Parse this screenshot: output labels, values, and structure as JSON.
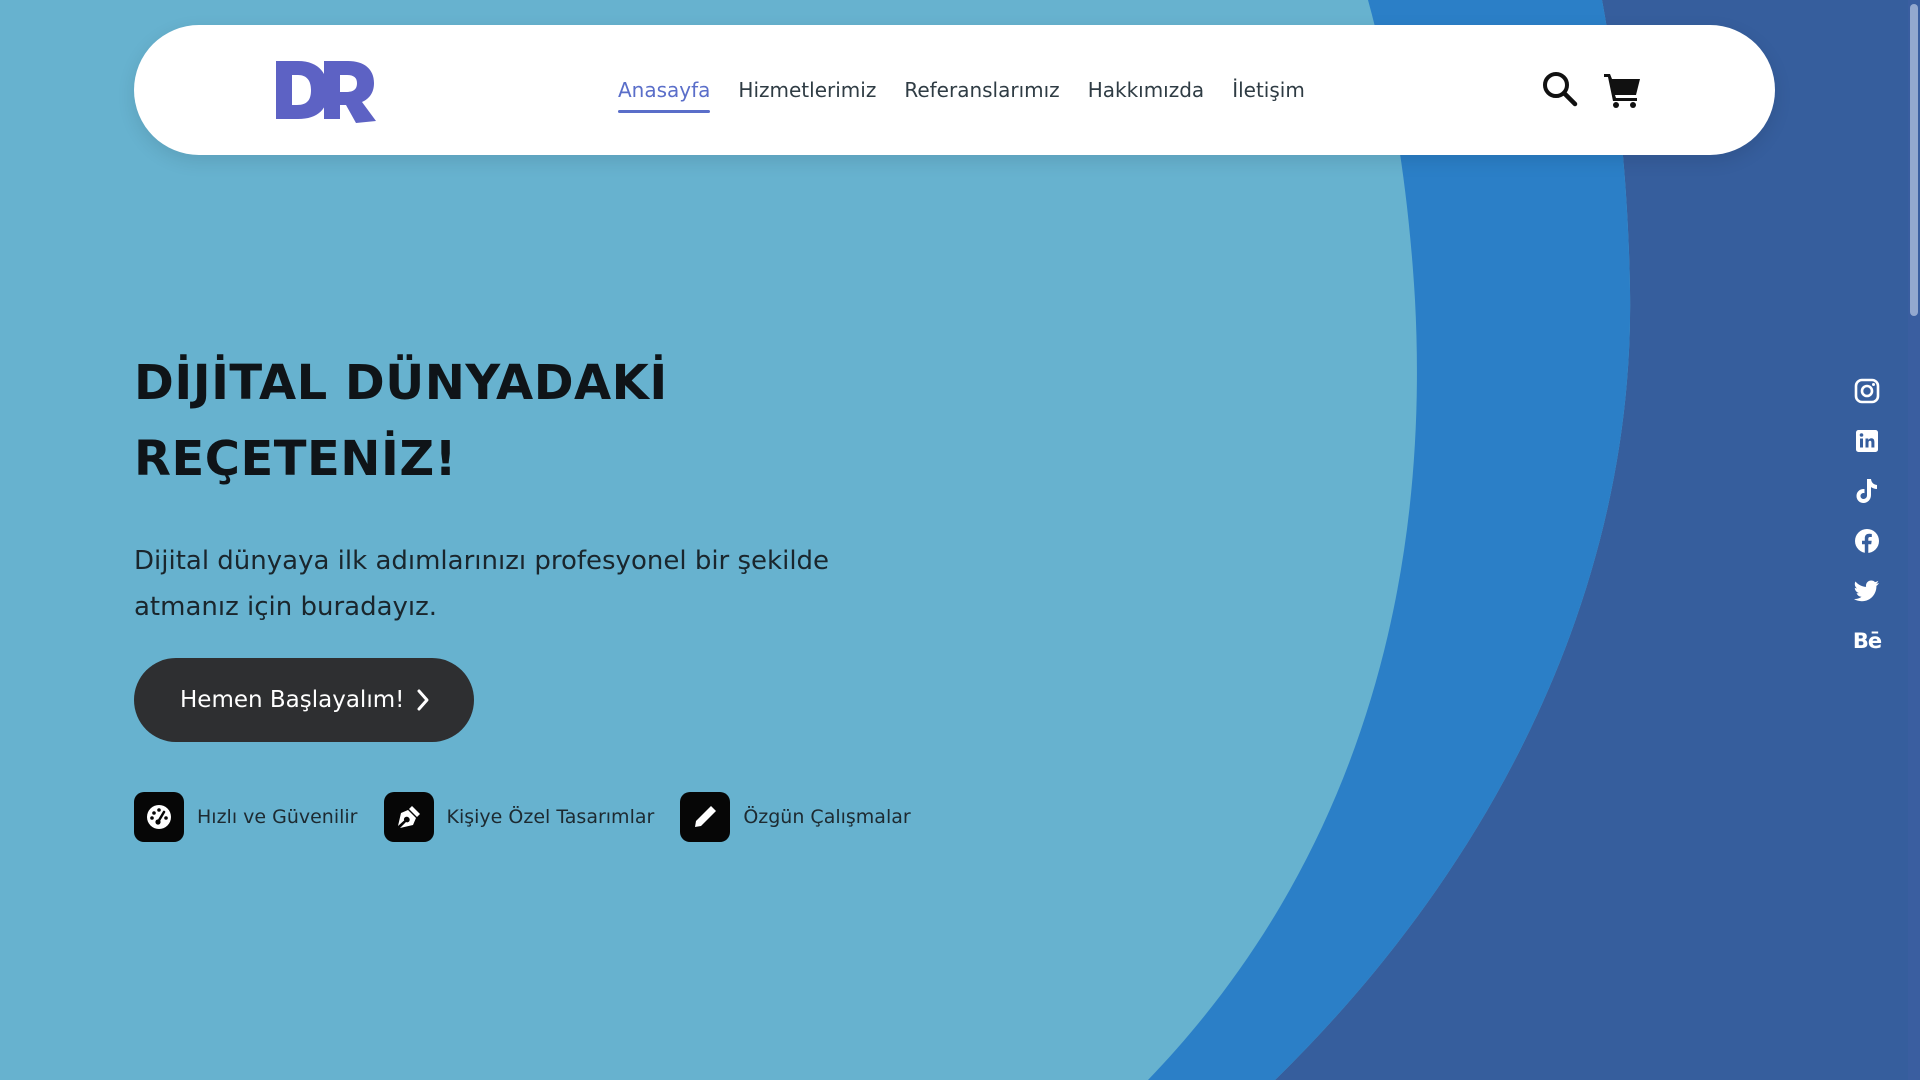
{
  "colors": {
    "page_bg": "#67b2cf",
    "mid_blue_arc": "#2b7fc7",
    "dark_blue_arc": "#365e9d",
    "accent": "#5a6ec9",
    "button_bg": "#2e2f31"
  },
  "header": {
    "logo_icon": "dr-logo-icon",
    "nav": [
      {
        "label": "Anasayfa",
        "active": true
      },
      {
        "label": "Hizmetlerimiz",
        "active": false
      },
      {
        "label": "Referanslarımız",
        "active": false
      },
      {
        "label": "Hakkımızda",
        "active": false
      },
      {
        "label": "İletişim",
        "active": false
      }
    ],
    "search_icon": "search-icon",
    "cart_icon": "cart-icon"
  },
  "hero": {
    "title_line1": "DİJİTAL DÜNYADAKİ",
    "title_line2": "REÇETENİZ!",
    "subtitle_line1": "Dijital dünyaya ilk adımlarınızı profesyonel bir şekilde",
    "subtitle_line2": "atmanız için buradayız.",
    "cta_label": "Hemen Başlayalım!"
  },
  "features": [
    {
      "label": "Hızlı ve Güvenilir",
      "icon": "speedometer-icon"
    },
    {
      "label": "Kişiye Özel Tasarımlar",
      "icon": "pen-nib-icon"
    },
    {
      "label": "Özgün Çalışmalar",
      "icon": "pencil-icon"
    }
  ],
  "social": {
    "instagram": "instagram-icon",
    "linkedin": "linkedin-icon",
    "tiktok": "tiktok-icon",
    "facebook": "facebook-icon",
    "twitter": "twitter-icon",
    "behance": "Bē"
  }
}
